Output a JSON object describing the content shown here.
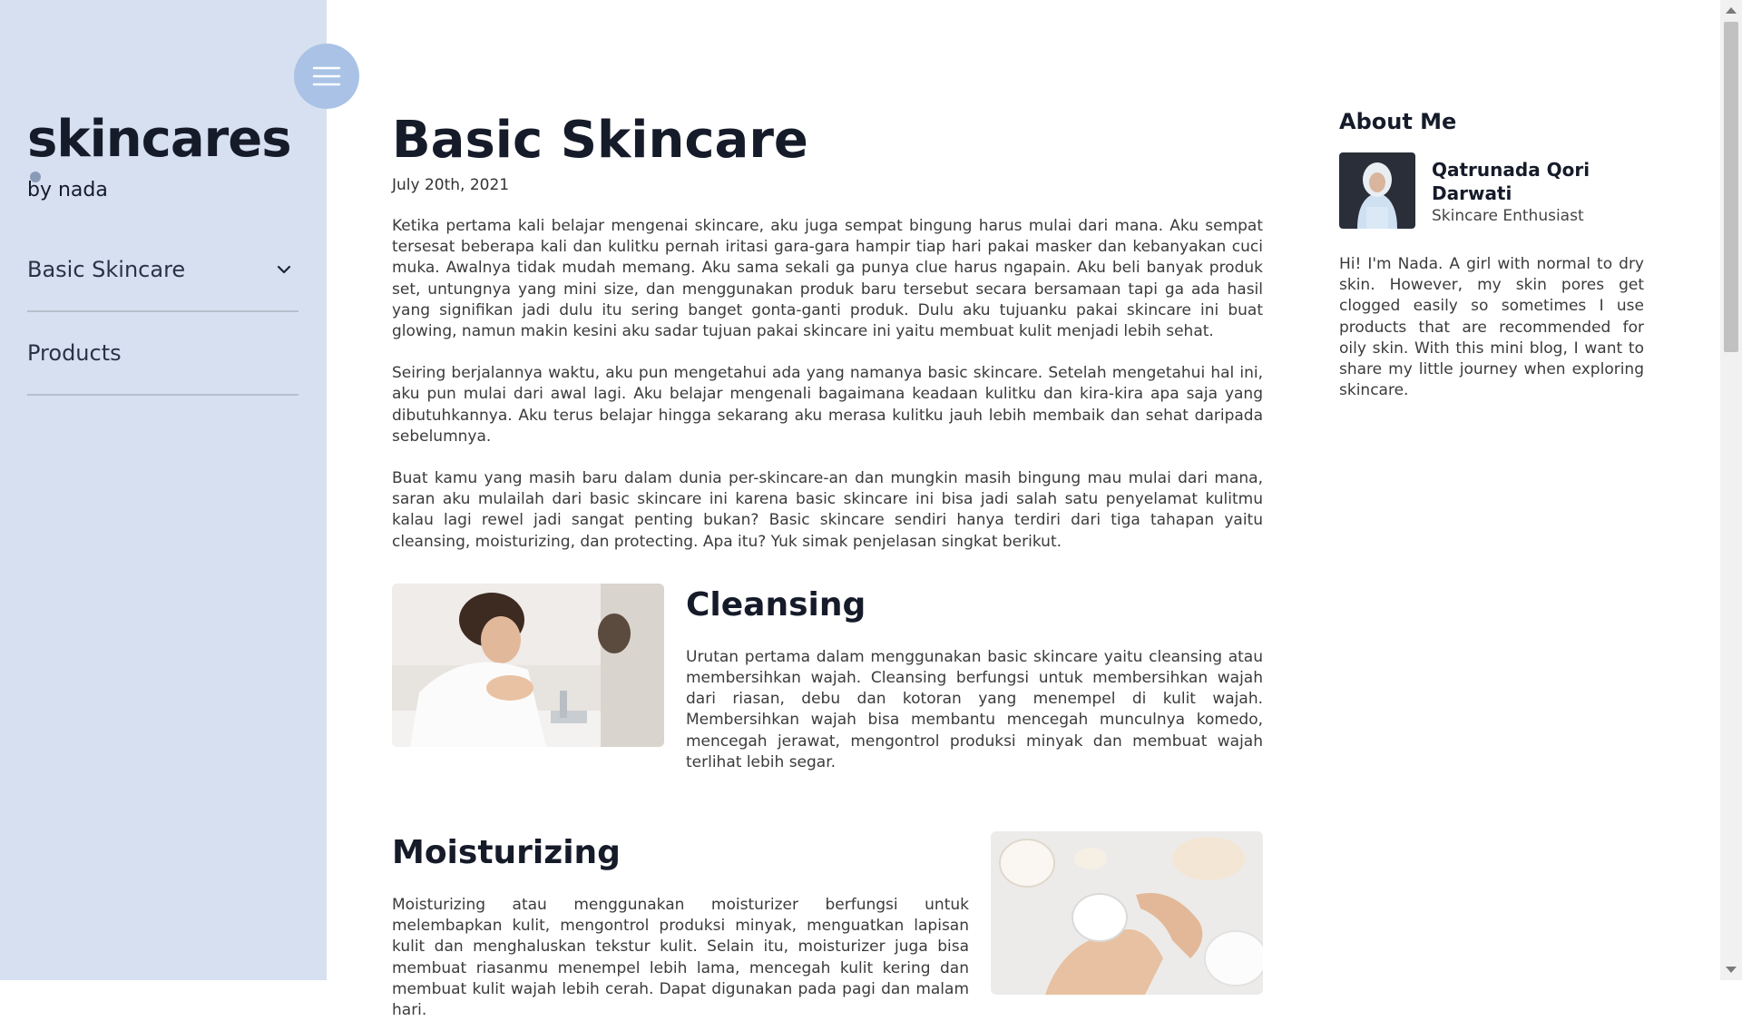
{
  "sidebar": {
    "brand_title": "skincares",
    "brand_sub": "by nada",
    "menu_icon": "hamburger-icon",
    "nav": [
      {
        "label": "Basic Skincare",
        "icon": "chevron-down-icon"
      },
      {
        "label": "Products"
      }
    ]
  },
  "article": {
    "title": "Basic Skincare",
    "date": "July 20th, 2021",
    "paragraphs": [
      "Ketika pertama kali belajar mengenai skincare, aku juga sempat bingung harus mulai dari mana. Aku sempat tersesat beberapa kali dan kulitku pernah iritasi gara-gara hampir tiap hari pakai masker dan kebanyakan cuci muka. Awalnya tidak mudah memang. Aku sama sekali ga punya clue harus ngapain. Aku beli banyak produk set, untungnya yang mini size, dan menggunakan produk baru tersebut secara bersamaan tapi ga ada hasil yang signifikan jadi dulu itu sering banget gonta-ganti produk. Dulu aku tujuanku pakai skincare ini buat glowing, namun makin kesini aku sadar tujuan pakai skincare ini yaitu membuat kulit menjadi lebih sehat.",
      "Seiring berjalannya waktu, aku pun mengetahui ada yang namanya basic skincare. Setelah mengetahui hal ini, aku pun mulai dari awal lagi. Aku belajar mengenali bagaimana keadaan kulitku dan kira-kira apa saja yang dibutuhkannya. Aku terus belajar hingga sekarang aku merasa kulitku jauh lebih membaik dan sehat daripada sebelumnya.",
      "Buat kamu yang masih baru dalam dunia per-skincare-an dan mungkin masih bingung mau mulai dari mana, saran aku mulailah dari basic skincare ini karena basic skincare ini bisa jadi salah satu penyelamat kulitmu kalau lagi rewel jadi sangat penting bukan? Basic skincare sendiri hanya terdiri dari tiga tahapan yaitu cleansing, moisturizing, dan protecting. Apa itu? Yuk simak penjelasan singkat berikut."
    ],
    "sections": [
      {
        "title": "Cleansing",
        "body": "Urutan pertama dalam menggunakan basic skincare yaitu cleansing atau membersihkan wajah. Cleansing berfungsi untuk membersihkan wajah dari riasan, debu dan kotoran yang menempel di kulit wajah. Membersihkan wajah bisa membantu mencegah munculnya komedo, mencegah jerawat, mengontrol produksi minyak dan membuat wajah terlihat lebih segar."
      },
      {
        "title": "Moisturizing",
        "body": "Moisturizing atau menggunakan moisturizer berfungsi untuk melembapkan kulit, mengontrol produksi minyak, menguatkan lapisan kulit dan menghaluskan tekstur kulit. Selain itu, moisturizer juga bisa membuat riasanmu menempel lebih lama, mencegah kulit kering dan membuat kulit wajah lebih cerah. Dapat digunakan pada pagi dan malam hari."
      }
    ]
  },
  "about": {
    "heading": "About Me",
    "name": "Qatrunada Qori Darwati",
    "role": "Skincare Enthusiast",
    "bio": "Hi! I'm Nada. A girl with normal to dry skin. However, my skin pores get clogged easily so sometimes I use products that are recommended for oily skin. With this mini blog, I want to share my little journey when exploring skincare."
  },
  "colors": {
    "sidebar_bg": "#d6e0f0",
    "menu_button": "#a9c2e6",
    "heading": "#161b2a"
  }
}
